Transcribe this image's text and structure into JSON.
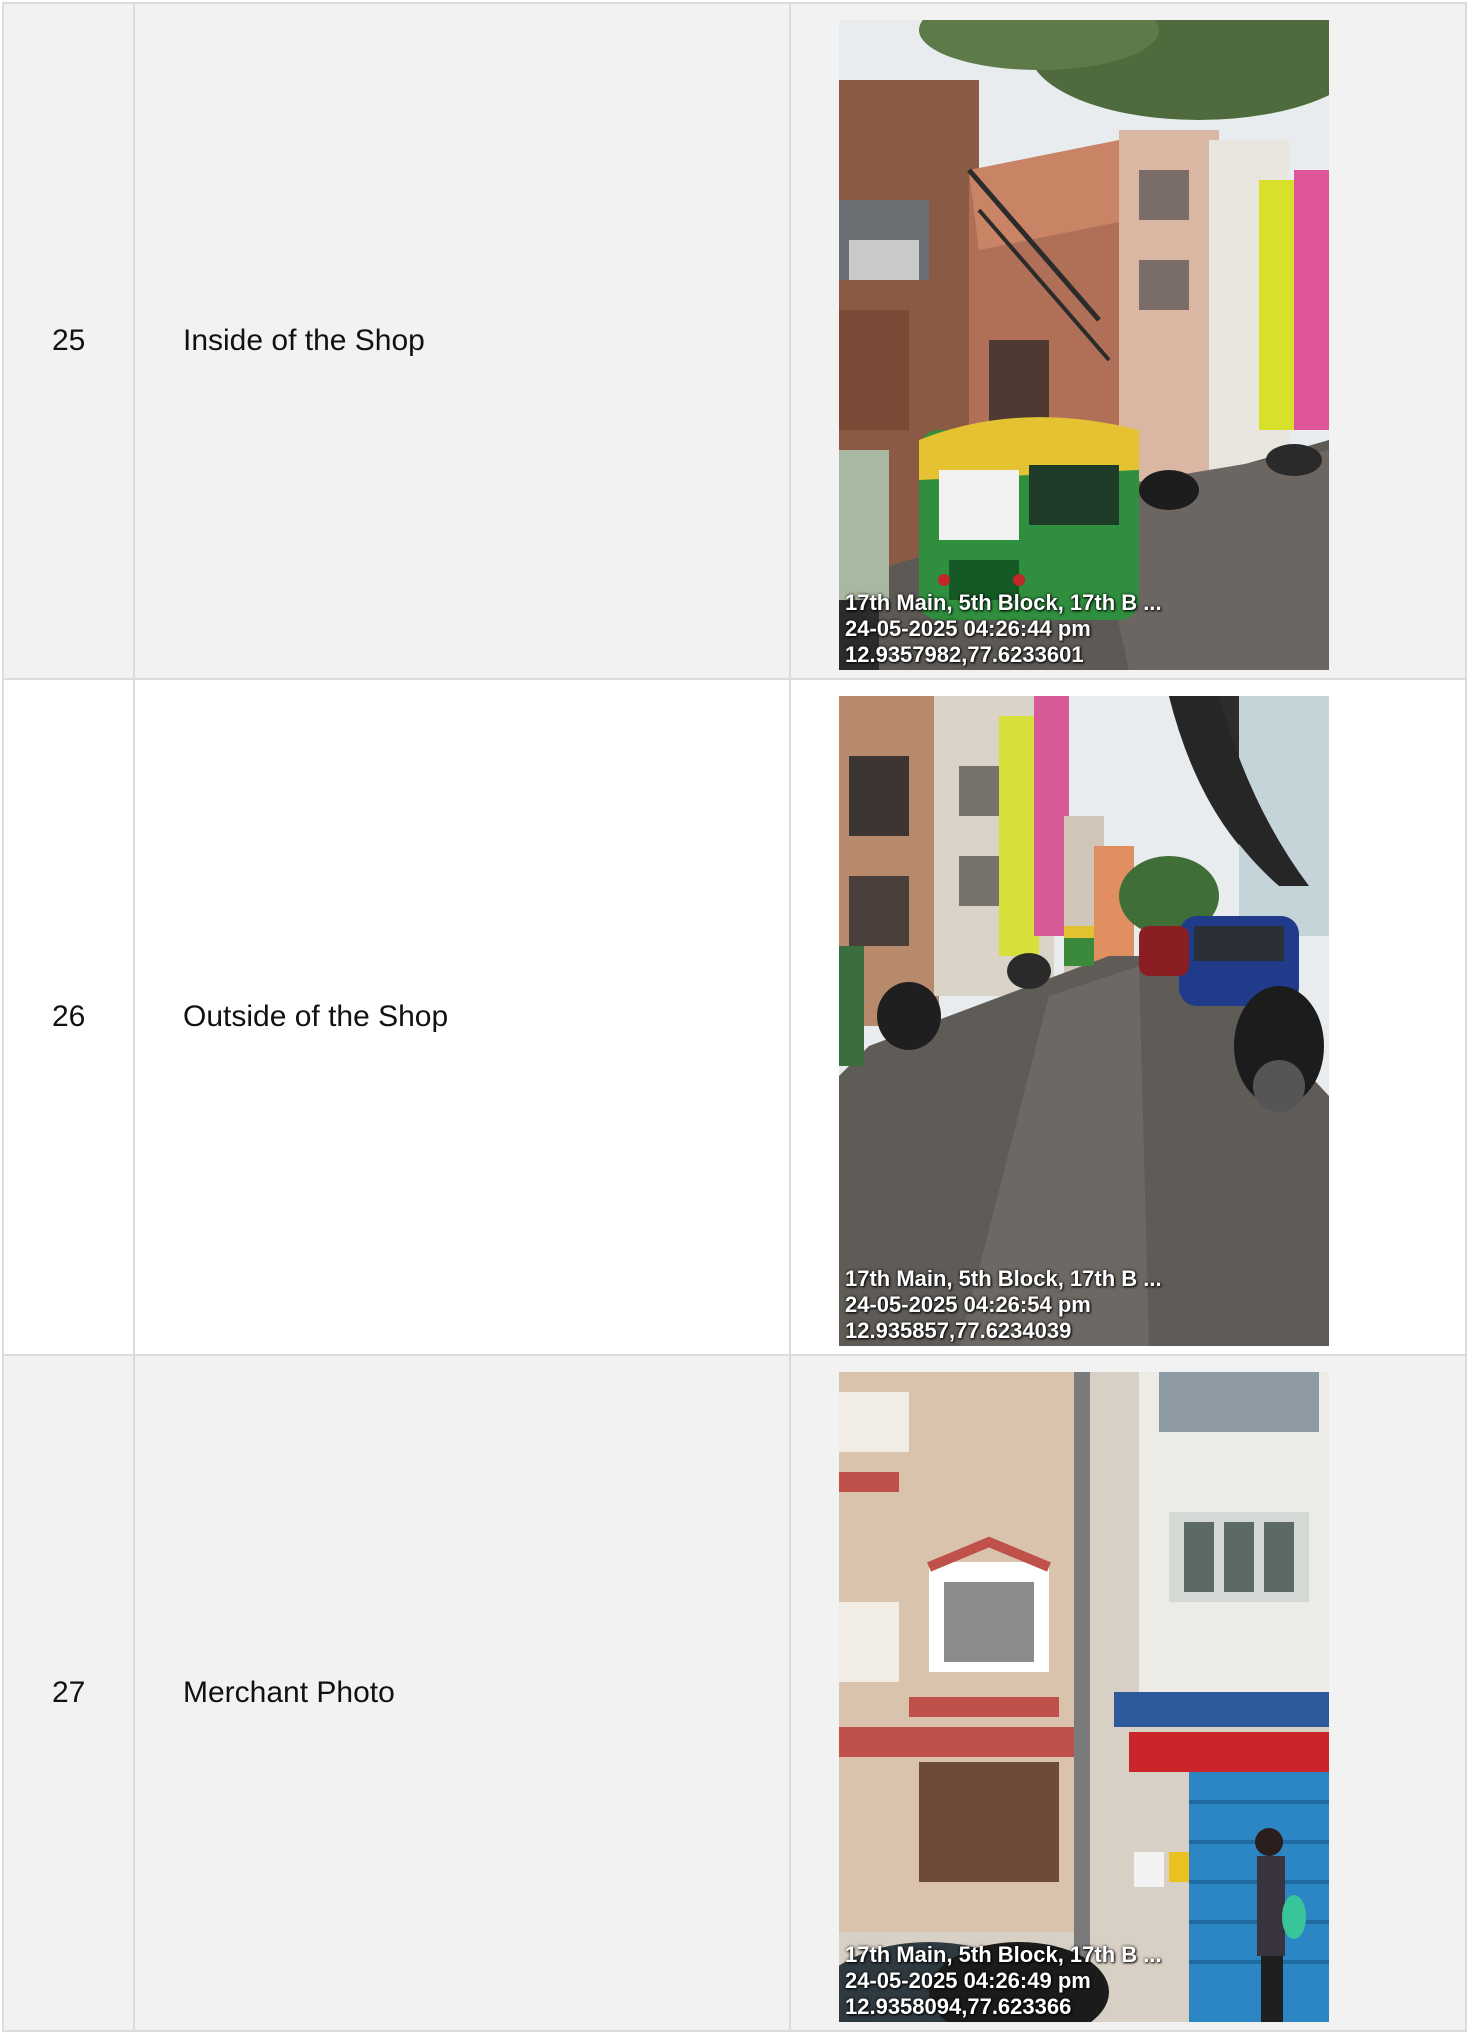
{
  "rows": [
    {
      "number": "25",
      "label": "Inside of the Shop",
      "photo": {
        "address": "17th Main, 5th Block, 17th B ...",
        "datetime": "24-05-2025 04:26:44 pm",
        "coordinates": "12.9357982,77.6233601"
      }
    },
    {
      "number": "26",
      "label": "Outside of the Shop",
      "photo": {
        "address": "17th Main, 5th Block, 17th B ...",
        "datetime": "24-05-2025 04:26:54 pm",
        "coordinates": "12.935857,77.6234039"
      }
    },
    {
      "number": "27",
      "label": "Merchant Photo",
      "photo": {
        "address": "17th Main, 5th Block, 17th B ...",
        "datetime": "24-05-2025 04:26:49 pm",
        "coordinates": "12.9358094,77.623366"
      }
    }
  ],
  "colors": {
    "row_shaded": "#f2f2f2",
    "row_plain": "#ffffff",
    "border": "#dcdcdc"
  }
}
